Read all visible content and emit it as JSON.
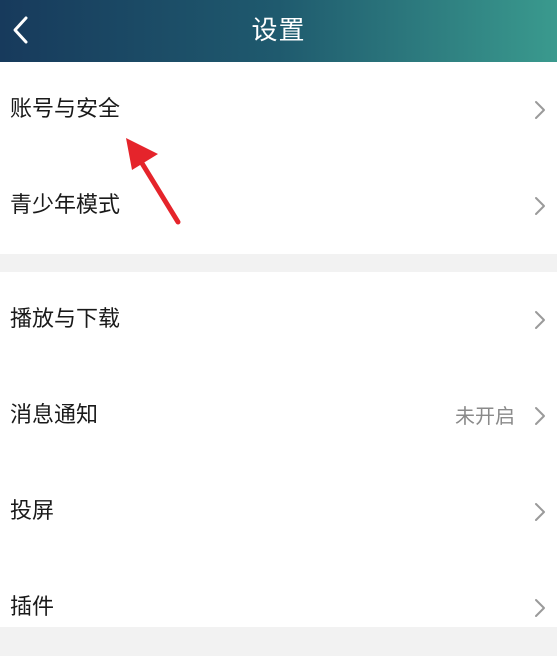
{
  "header": {
    "title": "设置",
    "back_icon": "chevron-left-icon",
    "gradient": [
      "#173a5c",
      "#1f5a6e",
      "#3a9a8e"
    ]
  },
  "groups": [
    {
      "items": [
        {
          "label": "账号与安全",
          "value": ""
        },
        {
          "label": "青少年模式",
          "value": ""
        }
      ]
    },
    {
      "items": [
        {
          "label": "播放与下载",
          "value": ""
        },
        {
          "label": "消息通知",
          "value": "未开启"
        },
        {
          "label": "投屏",
          "value": ""
        },
        {
          "label": "插件",
          "value": ""
        }
      ]
    }
  ],
  "annotation": {
    "type": "arrow",
    "color": "#e5242b",
    "icon": "red-arrow-annotation"
  }
}
